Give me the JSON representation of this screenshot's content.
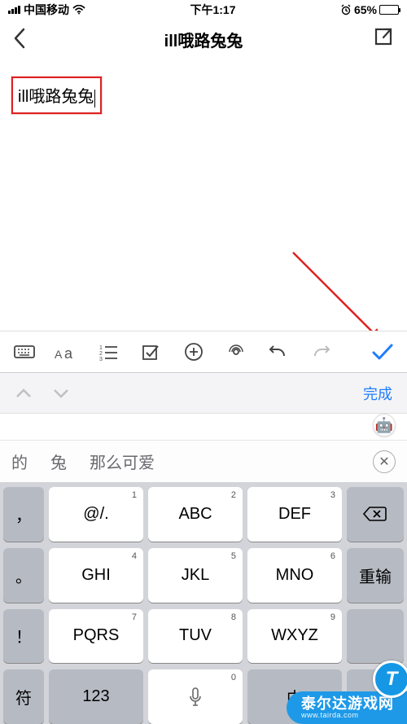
{
  "status": {
    "carrier": "中国移动",
    "time": "下午1:17",
    "battery_pct": "65%",
    "battery_fill_pct": 65
  },
  "nav": {
    "title": "ill哦路兔兔"
  },
  "editor": {
    "text": "ill哦路兔兔"
  },
  "accessory": {
    "done_label": "完成"
  },
  "suggestions": {
    "items": [
      "的",
      "兔",
      "那么可爱"
    ]
  },
  "keyboard": {
    "rows": [
      [
        {
          "main": "，",
          "num": "",
          "alt": true,
          "narrow": true,
          "name": "key-comma"
        },
        {
          "main": "@/.",
          "num": "1",
          "name": "key-1"
        },
        {
          "main": "ABC",
          "num": "2",
          "name": "key-2"
        },
        {
          "main": "DEF",
          "num": "3",
          "name": "key-3"
        },
        {
          "type": "backspace",
          "alt": true,
          "wide": true,
          "name": "key-backspace"
        }
      ],
      [
        {
          "main": "。",
          "num": "",
          "alt": true,
          "narrow": true,
          "name": "key-period"
        },
        {
          "main": "GHI",
          "num": "4",
          "name": "key-4"
        },
        {
          "main": "JKL",
          "num": "5",
          "name": "key-5"
        },
        {
          "main": "MNO",
          "num": "6",
          "name": "key-6"
        },
        {
          "main": "重输",
          "alt": true,
          "wide": true,
          "name": "key-clear"
        }
      ],
      [
        {
          "main": "！",
          "num": "",
          "alt": true,
          "narrow": true,
          "name": "key-exclaim"
        },
        {
          "main": "PQRS",
          "num": "7",
          "name": "key-7"
        },
        {
          "main": "TUV",
          "num": "8",
          "name": "key-8"
        },
        {
          "main": "WXYZ",
          "num": "9",
          "name": "key-9"
        },
        {
          "type": "blank",
          "alt": true,
          "wide": true,
          "name": "key-blank"
        }
      ],
      [
        {
          "main": "符",
          "alt": true,
          "narrow": true,
          "name": "key-symbols"
        },
        {
          "main": "123",
          "alt": true,
          "name": "key-numbers"
        },
        {
          "type": "mic",
          "name": "key-mic",
          "num": "0"
        },
        {
          "main": "中",
          "alt": true,
          "name": "key-lang"
        },
        {
          "type": "blank",
          "alt": true,
          "wide": true,
          "name": "key-blank2"
        }
      ]
    ]
  },
  "watermark": {
    "logo_letter": "T",
    "text": "泰尔达游戏网",
    "url": "www.tairda.com"
  }
}
